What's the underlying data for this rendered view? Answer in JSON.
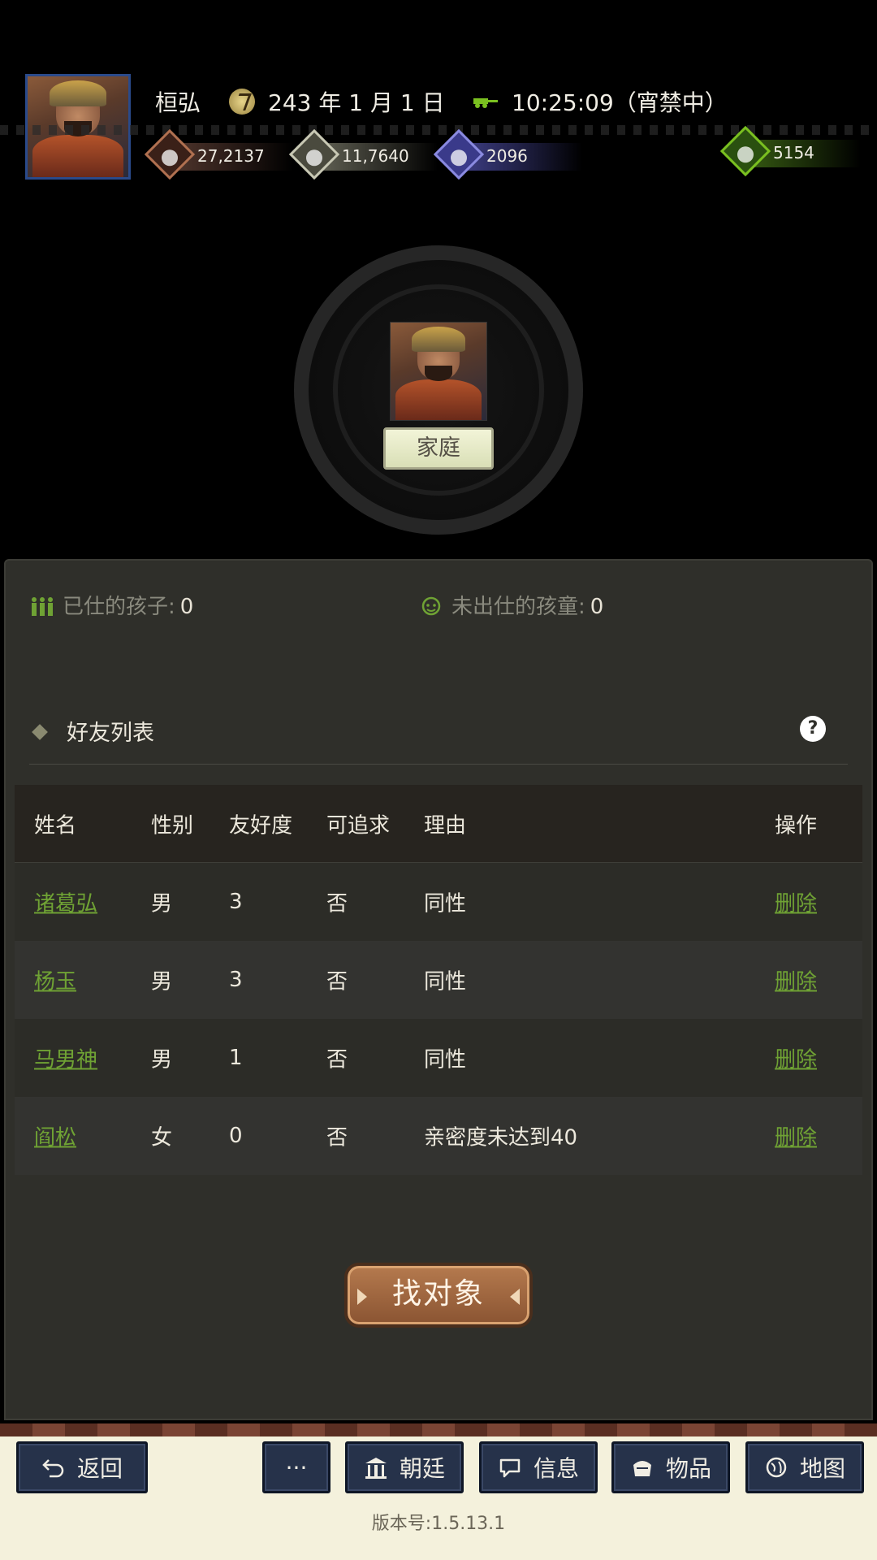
{
  "header": {
    "player_name": "桓弘",
    "date": "243 年 1 月 1 日",
    "time": "10:25:09（宵禁中）",
    "icons": {
      "date": "date-medal-icon",
      "time": "carriage-icon"
    },
    "resources": [
      {
        "icon": "coins-icon",
        "value": "27,2137"
      },
      {
        "icon": "grain-icon",
        "value": "11,7640"
      },
      {
        "icon": "soldier-icon",
        "value": "2096"
      },
      {
        "icon": "money-bag-icon",
        "value": "5154"
      }
    ]
  },
  "center": {
    "badge": "家庭"
  },
  "stats": {
    "employed_children_label": "已仕的孩子:",
    "employed_children_value": "0",
    "unemployed_children_label": "未出仕的孩童:",
    "unemployed_children_value": "0"
  },
  "friends": {
    "title": "好友列表",
    "help": "?",
    "columns": [
      "姓名",
      "性别",
      "友好度",
      "可追求",
      "理由",
      "操作"
    ],
    "rows": [
      {
        "name": "诸葛弘",
        "sex": "男",
        "favor": "3",
        "pursue": "否",
        "reason": "同性",
        "action": "删除"
      },
      {
        "name": "杨玉",
        "sex": "男",
        "favor": "3",
        "pursue": "否",
        "reason": "同性",
        "action": "删除"
      },
      {
        "name": "马男神",
        "sex": "男",
        "favor": "1",
        "pursue": "否",
        "reason": "同性",
        "action": "删除"
      },
      {
        "name": "阎松",
        "sex": "女",
        "favor": "0",
        "pursue": "否",
        "reason": "亲密度未达到40",
        "action": "删除"
      }
    ],
    "find_button": "找对象"
  },
  "nav": {
    "back": "返回",
    "more": "···",
    "court": "朝廷",
    "info": "信息",
    "items": "物品",
    "map": "地图"
  },
  "version": "版本号:1.5.13.1",
  "colors": {
    "link_green": "#6fa234",
    "panel_bg": "#2f2f2a",
    "nav_button_bg": "#26324a",
    "bottom_bar_bg": "#f4f1dc"
  }
}
